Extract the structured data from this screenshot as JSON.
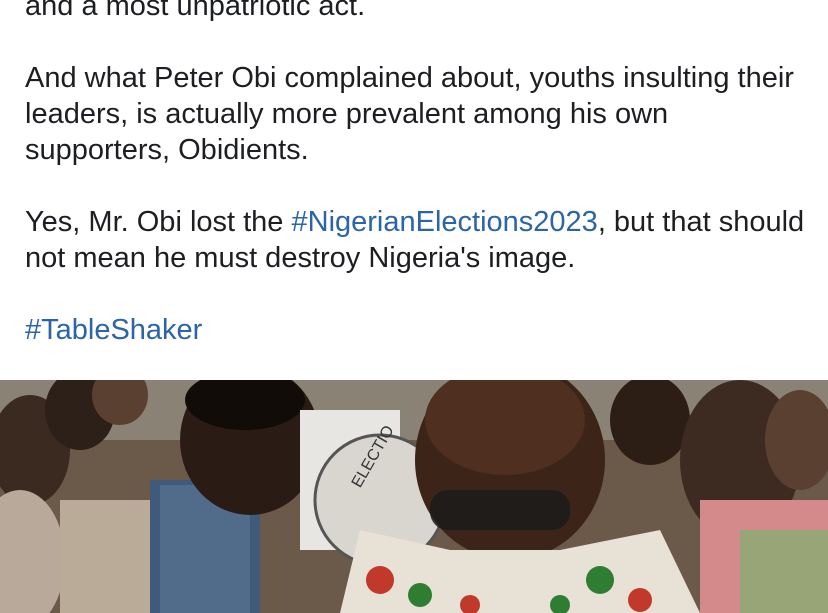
{
  "post": {
    "partial_line": "and a most unpatriotic act.",
    "para2": "And what Peter Obi complained about, youths insulting their leaders, is actually more prevalent among his own supporters, Obidients.",
    "para3_before": "Yes, Mr. Obi lost the ",
    "para3_hashtag": "#NigerianElections2023",
    "para3_after": ", but that should not mean he must destroy Nigeria's image.",
    "hashtag_final": "#TableShaker"
  },
  "photo": {
    "description_icon": "photo-attachment",
    "visible_text": "ELECTIO"
  },
  "colors": {
    "text": "#1c1e21",
    "hashtag": "#2b64a8",
    "background": "#ffffff"
  }
}
